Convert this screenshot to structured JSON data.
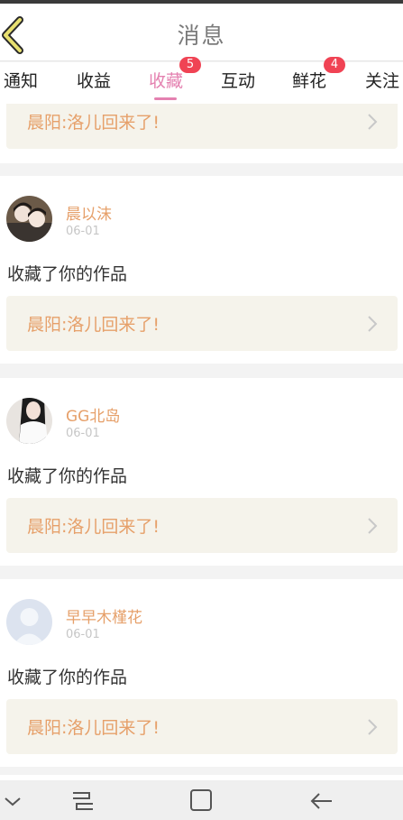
{
  "header": {
    "title": "消息",
    "back_icon": "chevron-left-icon"
  },
  "tabs": [
    {
      "label": "通知",
      "badge": ""
    },
    {
      "label": "收益",
      "badge": ""
    },
    {
      "label": "收藏",
      "badge": "5",
      "active": true
    },
    {
      "label": "互动",
      "badge": ""
    },
    {
      "label": "鲜花",
      "badge": "4"
    },
    {
      "label": "关注",
      "badge": ""
    }
  ],
  "colors": {
    "accent": "#e481b0",
    "badge": "#f04354",
    "username": "#e6a06a",
    "work_bg": "#f5f3eb"
  },
  "feed": {
    "partial_work_title": "晨阳:洛儿回来了!",
    "items": [
      {
        "user": "晨以沫",
        "date": "06-01",
        "action": "收藏了你的作品",
        "work_title": "晨阳:洛儿回来了!"
      },
      {
        "user": "GG北岛",
        "date": "06-01",
        "action": "收藏了你的作品",
        "work_title": "晨阳:洛儿回来了!"
      },
      {
        "user": "早早木槿花",
        "date": "06-01",
        "action": "收藏了你的作品",
        "work_title": "晨阳:洛儿回来了!"
      }
    ]
  },
  "navbar": {
    "icons": [
      "chevron-down-icon",
      "recent-apps-icon",
      "home-icon",
      "back-icon"
    ]
  }
}
